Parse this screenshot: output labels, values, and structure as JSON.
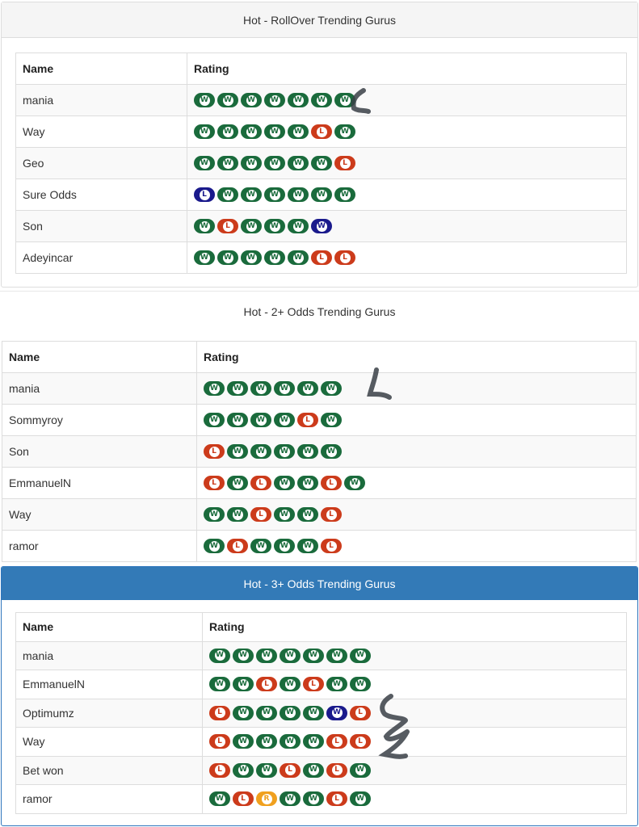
{
  "colors": {
    "win": "#1a6b3c",
    "loss": "#cc3b1b",
    "blue_win": "#1a1a8c",
    "refund": "#f0a01e",
    "panel_accent": "#337ab7"
  },
  "tables": [
    {
      "title": "Hot - RollOver Trending Gurus",
      "col_name": "Name",
      "col_rating": "Rating",
      "rows": [
        {
          "name": "mania",
          "ratings": [
            [
              "W",
              "W"
            ],
            [
              "W",
              "W"
            ],
            [
              "W",
              "W"
            ],
            [
              "W",
              "W"
            ],
            [
              "W",
              "W"
            ],
            [
              "W",
              "W"
            ],
            [
              "W",
              "W"
            ]
          ]
        },
        {
          "name": "Way",
          "ratings": [
            [
              "W",
              "W"
            ],
            [
              "W",
              "W"
            ],
            [
              "W",
              "W"
            ],
            [
              "W",
              "W"
            ],
            [
              "W",
              "W"
            ],
            [
              "L",
              "L"
            ],
            [
              "W",
              "W"
            ]
          ]
        },
        {
          "name": "Geo",
          "ratings": [
            [
              "W",
              "W"
            ],
            [
              "W",
              "W"
            ],
            [
              "W",
              "W"
            ],
            [
              "W",
              "W"
            ],
            [
              "W",
              "W"
            ],
            [
              "W",
              "W"
            ],
            [
              "L",
              "L"
            ]
          ]
        },
        {
          "name": "Sure Odds",
          "ratings": [
            [
              "L",
              "B"
            ],
            [
              "W",
              "W"
            ],
            [
              "W",
              "W"
            ],
            [
              "W",
              "W"
            ],
            [
              "W",
              "W"
            ],
            [
              "W",
              "W"
            ],
            [
              "W",
              "W"
            ]
          ]
        },
        {
          "name": "Son",
          "ratings": [
            [
              "W",
              "W"
            ],
            [
              "L",
              "L"
            ],
            [
              "W",
              "W"
            ],
            [
              "W",
              "W"
            ],
            [
              "W",
              "W"
            ],
            [
              "W",
              "B"
            ]
          ]
        },
        {
          "name": "Adeyincar",
          "ratings": [
            [
              "W",
              "W"
            ],
            [
              "W",
              "W"
            ],
            [
              "W",
              "W"
            ],
            [
              "W",
              "W"
            ],
            [
              "W",
              "W"
            ],
            [
              "L",
              "L"
            ],
            [
              "L",
              "L"
            ]
          ]
        }
      ]
    },
    {
      "title": "Hot - 2+ Odds Trending Gurus",
      "col_name": "Name",
      "col_rating": "Rating",
      "rows": [
        {
          "name": "mania",
          "ratings": [
            [
              "W",
              "W"
            ],
            [
              "W",
              "W"
            ],
            [
              "W",
              "W"
            ],
            [
              "W",
              "W"
            ],
            [
              "W",
              "W"
            ],
            [
              "W",
              "W"
            ]
          ]
        },
        {
          "name": "Sommyroy",
          "ratings": [
            [
              "W",
              "W"
            ],
            [
              "W",
              "W"
            ],
            [
              "W",
              "W"
            ],
            [
              "W",
              "W"
            ],
            [
              "L",
              "L"
            ],
            [
              "W",
              "W"
            ]
          ]
        },
        {
          "name": "Son",
          "ratings": [
            [
              "L",
              "L"
            ],
            [
              "W",
              "W"
            ],
            [
              "W",
              "W"
            ],
            [
              "W",
              "W"
            ],
            [
              "W",
              "W"
            ],
            [
              "W",
              "W"
            ]
          ]
        },
        {
          "name": "EmmanuelN",
          "ratings": [
            [
              "L",
              "L"
            ],
            [
              "W",
              "W"
            ],
            [
              "L",
              "L"
            ],
            [
              "W",
              "W"
            ],
            [
              "W",
              "W"
            ],
            [
              "L",
              "L"
            ],
            [
              "W",
              "W"
            ]
          ]
        },
        {
          "name": "Way",
          "ratings": [
            [
              "W",
              "W"
            ],
            [
              "W",
              "W"
            ],
            [
              "L",
              "L"
            ],
            [
              "W",
              "W"
            ],
            [
              "W",
              "W"
            ],
            [
              "L",
              "L"
            ]
          ]
        },
        {
          "name": "ramor",
          "ratings": [
            [
              "W",
              "W"
            ],
            [
              "L",
              "L"
            ],
            [
              "W",
              "W"
            ],
            [
              "W",
              "W"
            ],
            [
              "W",
              "W"
            ],
            [
              "L",
              "L"
            ]
          ]
        }
      ]
    },
    {
      "title": "Hot - 3+ Odds Trending Gurus",
      "col_name": "Name",
      "col_rating": "Rating",
      "rows": [
        {
          "name": "mania",
          "ratings": [
            [
              "W",
              "W"
            ],
            [
              "W",
              "W"
            ],
            [
              "W",
              "W"
            ],
            [
              "W",
              "W"
            ],
            [
              "W",
              "W"
            ],
            [
              "W",
              "W"
            ],
            [
              "W",
              "W"
            ]
          ]
        },
        {
          "name": "EmmanuelN",
          "ratings": [
            [
              "W",
              "W"
            ],
            [
              "W",
              "W"
            ],
            [
              "L",
              "L"
            ],
            [
              "W",
              "W"
            ],
            [
              "L",
              "L"
            ],
            [
              "W",
              "W"
            ],
            [
              "W",
              "W"
            ]
          ]
        },
        {
          "name": "Optimumz",
          "ratings": [
            [
              "L",
              "L"
            ],
            [
              "W",
              "W"
            ],
            [
              "W",
              "W"
            ],
            [
              "W",
              "W"
            ],
            [
              "W",
              "W"
            ],
            [
              "W",
              "B"
            ],
            [
              "L",
              "L"
            ]
          ]
        },
        {
          "name": "Way",
          "ratings": [
            [
              "L",
              "L"
            ],
            [
              "W",
              "W"
            ],
            [
              "W",
              "W"
            ],
            [
              "W",
              "W"
            ],
            [
              "W",
              "W"
            ],
            [
              "L",
              "L"
            ],
            [
              "L",
              "L"
            ]
          ]
        },
        {
          "name": "Bet won",
          "ratings": [
            [
              "L",
              "L"
            ],
            [
              "W",
              "W"
            ],
            [
              "W",
              "W"
            ],
            [
              "L",
              "L"
            ],
            [
              "W",
              "W"
            ],
            [
              "L",
              "L"
            ],
            [
              "W",
              "W"
            ]
          ]
        },
        {
          "name": "ramor",
          "ratings": [
            [
              "W",
              "W"
            ],
            [
              "L",
              "L"
            ],
            [
              "R",
              "R"
            ],
            [
              "W",
              "W"
            ],
            [
              "W",
              "W"
            ],
            [
              "L",
              "L"
            ],
            [
              "W",
              "W"
            ]
          ]
        }
      ]
    }
  ]
}
